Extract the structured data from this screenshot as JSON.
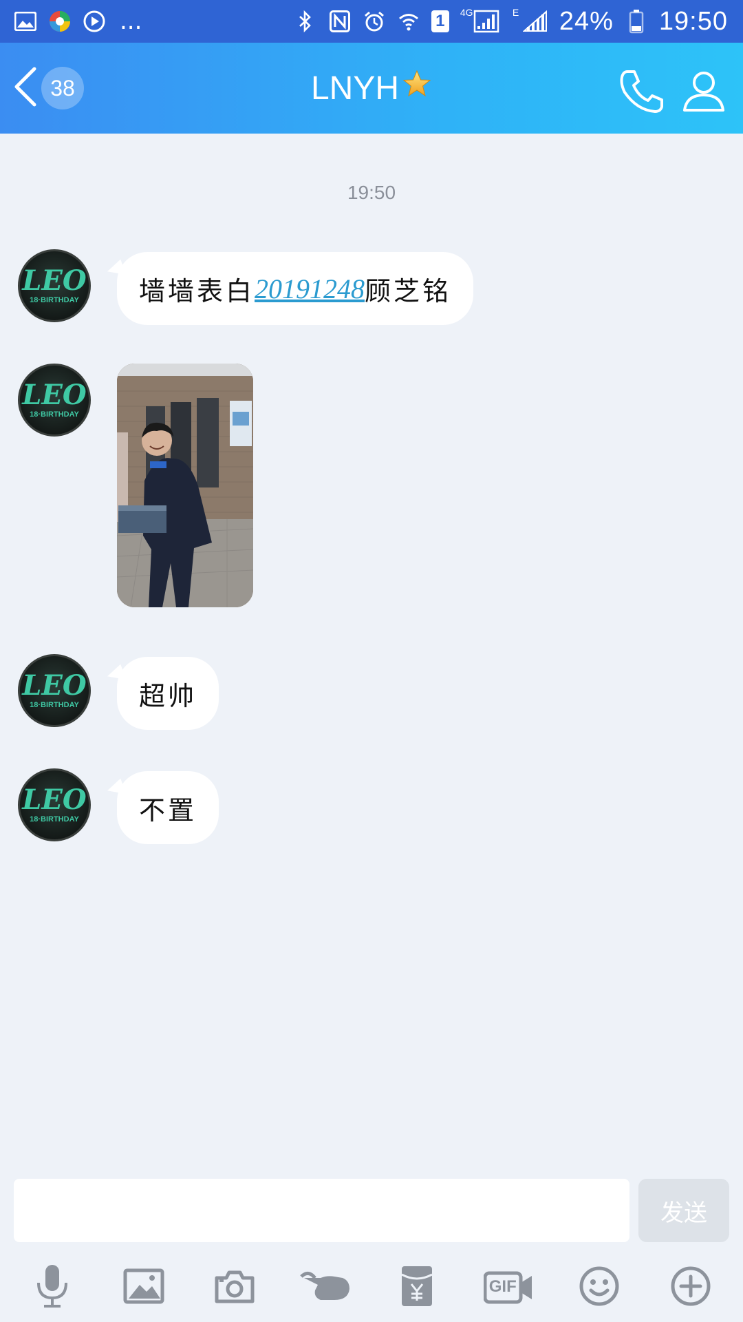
{
  "status_bar": {
    "battery": "24%",
    "time": "19:50",
    "network": "4G",
    "network2": "E",
    "sim": "1",
    "dots": "..."
  },
  "header": {
    "unread_count": "38",
    "title": "LNYH"
  },
  "chat": {
    "timestamp": "19:50",
    "messages": [
      {
        "type": "text",
        "prefix": "墙墙表白",
        "link": "20191248",
        "suffix": "顾芝铭"
      },
      {
        "type": "image"
      },
      {
        "type": "text",
        "text": "超帅"
      },
      {
        "type": "text",
        "text": "不置"
      }
    ],
    "avatar_text_large": "LEO",
    "avatar_text_small": "18·BIRTHDAY"
  },
  "input": {
    "placeholder": "",
    "send_label": "发送"
  },
  "toolbar": {
    "gif_label": "GIF",
    "icons": [
      "mic-icon",
      "image-icon",
      "camera-icon",
      "poke-icon",
      "red-packet-icon",
      "gif-icon",
      "emoji-icon",
      "plus-icon"
    ]
  },
  "colors": {
    "status_bar": "#2f64d4",
    "header_start": "#3b8df2",
    "header_end": "#2dc3f8",
    "background": "#eef2f8",
    "link": "#2b9bd0",
    "icon_gray": "#8d939c"
  }
}
